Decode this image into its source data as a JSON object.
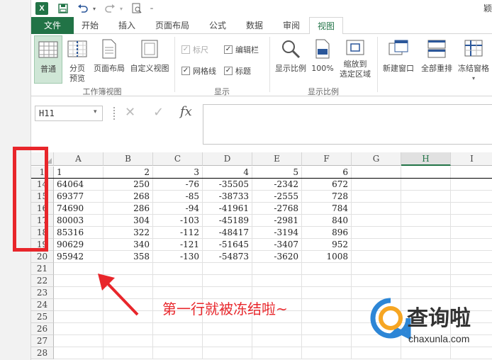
{
  "titlebar": {
    "partial_title": "颖"
  },
  "tabs": [
    {
      "label": "文件"
    },
    {
      "label": "开始"
    },
    {
      "label": "插入"
    },
    {
      "label": "页面布局"
    },
    {
      "label": "公式"
    },
    {
      "label": "数据"
    },
    {
      "label": "审阅"
    },
    {
      "label": "视图"
    }
  ],
  "ribbon": {
    "workbook_views": {
      "buttons": [
        "普通",
        "分页\n预览",
        "页面布局",
        "自定义视图"
      ],
      "group_label": "工作簿视图"
    },
    "show": {
      "checkboxes": [
        {
          "label": "标尺",
          "checked": true,
          "disabled": true
        },
        {
          "label": "编辑栏",
          "checked": true,
          "disabled": false
        },
        {
          "label": "网格线",
          "checked": true,
          "disabled": false
        },
        {
          "label": "标题",
          "checked": true,
          "disabled": false
        }
      ],
      "group_label": "显示"
    },
    "zoom": {
      "buttons": [
        "显示比例",
        "100%",
        "缩放到\n选定区域"
      ],
      "group_label": "显示比例"
    },
    "window": {
      "buttons": [
        "新建窗口",
        "全部重排",
        "冻结窗格"
      ]
    }
  },
  "formula_bar": {
    "name_box": "H11",
    "fx": "fx"
  },
  "sheet": {
    "columns": [
      "A",
      "B",
      "C",
      "D",
      "E",
      "F",
      "G",
      "H",
      "I"
    ],
    "selected_column": "H",
    "rows": [
      {
        "num": "1",
        "cells": [
          "1",
          "2",
          "3",
          "4",
          "5",
          "6"
        ]
      },
      {
        "num": "14",
        "cells": [
          "64064",
          "250",
          "-76",
          "-35505",
          "-2342",
          "672"
        ]
      },
      {
        "num": "15",
        "cells": [
          "69377",
          "268",
          "-85",
          "-38733",
          "-2555",
          "728"
        ]
      },
      {
        "num": "16",
        "cells": [
          "74690",
          "286",
          "-94",
          "-41961",
          "-2768",
          "784"
        ]
      },
      {
        "num": "17",
        "cells": [
          "80003",
          "304",
          "-103",
          "-45189",
          "-2981",
          "840"
        ]
      },
      {
        "num": "18",
        "cells": [
          "85316",
          "322",
          "-112",
          "-48417",
          "-3194",
          "896"
        ]
      },
      {
        "num": "19",
        "cells": [
          "90629",
          "340",
          "-121",
          "-51645",
          "-3407",
          "952"
        ]
      },
      {
        "num": "20",
        "cells": [
          "95942",
          "358",
          "-130",
          "-54873",
          "-3620",
          "1008"
        ]
      },
      {
        "num": "21",
        "cells": []
      },
      {
        "num": "22",
        "cells": []
      },
      {
        "num": "23",
        "cells": []
      },
      {
        "num": "24",
        "cells": []
      },
      {
        "num": "25",
        "cells": []
      },
      {
        "num": "26",
        "cells": []
      },
      {
        "num": "27",
        "cells": []
      },
      {
        "num": "28",
        "cells": []
      }
    ]
  },
  "annotation": {
    "text": "第一行就被冻结啦~",
    "color": "#e8262b"
  },
  "watermark": {
    "brand": "查询啦",
    "site": "chaxunla.com"
  }
}
